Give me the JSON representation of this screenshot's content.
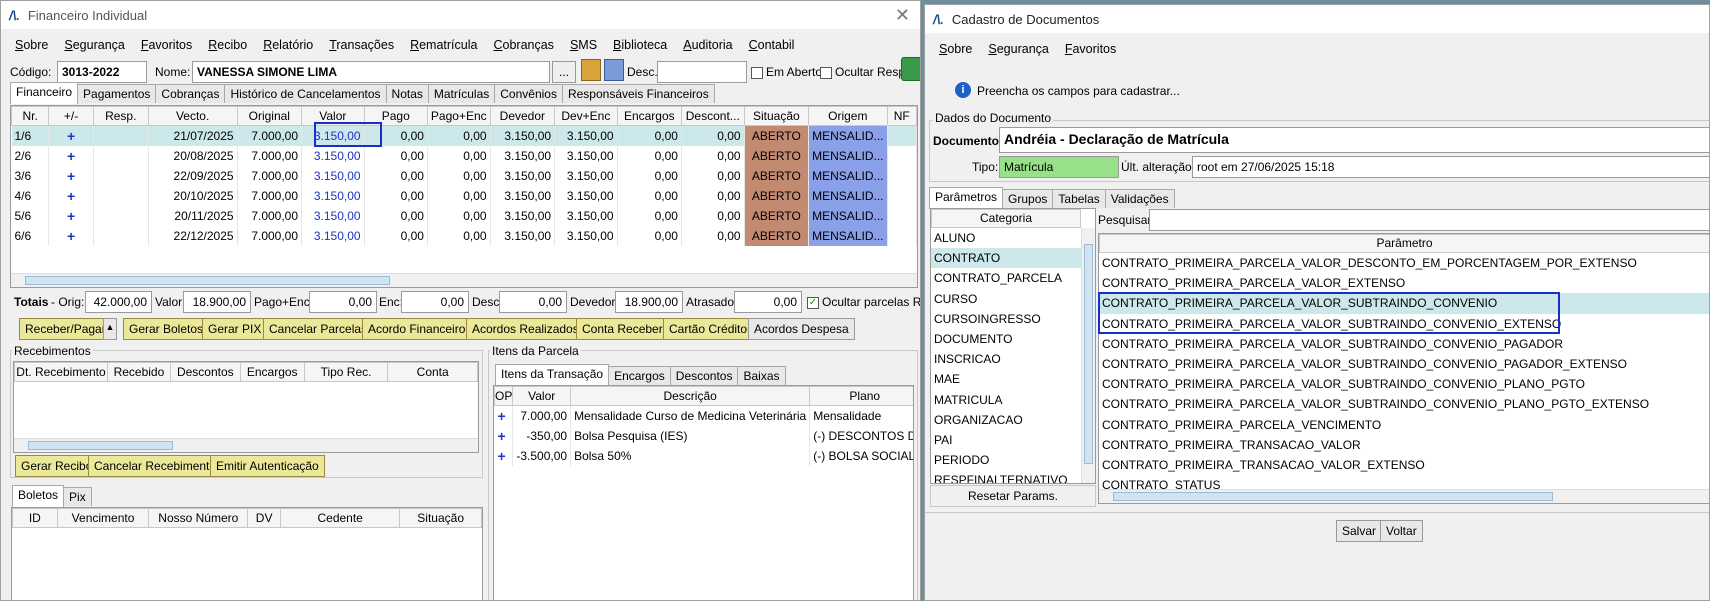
{
  "left": {
    "title": "Financeiro Individual",
    "menu": [
      "Sobre",
      "Segurança",
      "Favoritos",
      "Recibo",
      "Relatório",
      "Transações",
      "Rematrícula",
      "Cobranças",
      "SMS",
      "Biblioteca",
      "Auditoria",
      "Contabil"
    ],
    "codigo_label": "Código:",
    "codigo": "3013-2022",
    "nome_label": "Nome:",
    "nome": "VANESSA SIMONE LIMA",
    "ellipsis": "...",
    "desc_label": "Desc.:",
    "em_aberto": "Em Aberto",
    "ocultar_resp": "Ocultar Resp.",
    "tabs": [
      "Financeiro",
      "Pagamentos",
      "Cobranças",
      "Histórico de Cancelamentos",
      "Notas",
      "Matrículas",
      "Convênios",
      "Responsáveis Financeiros"
    ],
    "columns": [
      "Nr.",
      "+/-",
      "Resp.",
      "Vecto.",
      "Original",
      "Valor",
      "Pago",
      "Pago+Enc",
      "Devedor",
      "Dev+Enc",
      "Encargos",
      "Descont...",
      "Situação",
      "Origem",
      "NF"
    ],
    "rows": [
      [
        "1/6",
        "+",
        "",
        "21/07/2025",
        "7.000,00",
        "3.150,00",
        "0,00",
        "0,00",
        "3.150,00",
        "3.150,00",
        "0,00",
        "0,00",
        "ABERTO",
        "MENSALID..."
      ],
      [
        "2/6",
        "+",
        "",
        "20/08/2025",
        "7.000,00",
        "3.150,00",
        "0,00",
        "0,00",
        "3.150,00",
        "3.150,00",
        "0,00",
        "0,00",
        "ABERTO",
        "MENSALID..."
      ],
      [
        "3/6",
        "+",
        "",
        "22/09/2025",
        "7.000,00",
        "3.150,00",
        "0,00",
        "0,00",
        "3.150,00",
        "3.150,00",
        "0,00",
        "0,00",
        "ABERTO",
        "MENSALID..."
      ],
      [
        "4/6",
        "+",
        "",
        "20/10/2025",
        "7.000,00",
        "3.150,00",
        "0,00",
        "0,00",
        "3.150,00",
        "3.150,00",
        "0,00",
        "0,00",
        "ABERTO",
        "MENSALID..."
      ],
      [
        "5/6",
        "+",
        "",
        "20/11/2025",
        "7.000,00",
        "3.150,00",
        "0,00",
        "0,00",
        "3.150,00",
        "3.150,00",
        "0,00",
        "0,00",
        "ABERTO",
        "MENSALID..."
      ],
      [
        "6/6",
        "+",
        "",
        "22/12/2025",
        "7.000,00",
        "3.150,00",
        "0,00",
        "0,00",
        "3.150,00",
        "3.150,00",
        "0,00",
        "0,00",
        "ABERTO",
        "MENSALID..."
      ]
    ],
    "totais": {
      "label": "Totais",
      "orig_label": "- Orig:",
      "orig": "42.000,00",
      "valor_label": "Valor:",
      "valor": "18.900,00",
      "pagoenc_label": "Pago+Enc:",
      "pagoenc": "0,00",
      "enc_label": "Enc:",
      "enc": "0,00",
      "desc_label": "Desc:",
      "desc": "0,00",
      "devedor_label": "Devedor:",
      "devedor": "18.900,00",
      "atrasado_label": "Atrasado:",
      "atrasado": "0,00",
      "ocultar": "Ocultar parcelas RC"
    },
    "buttons": [
      "Receber/Pagar",
      "Gerar Boletos",
      "Gerar PIX",
      "Cancelar Parcelas",
      "Acordo Financeiro",
      "Acordos Realizados",
      "Conta Receber",
      "Cartão Crédito",
      "Acordos Despesa"
    ],
    "recebimentos": {
      "title": "Recebimentos",
      "columns": [
        "Dt. Recebimento",
        "Recebido",
        "Descontos",
        "Encargos",
        "Tipo Rec.",
        "Conta"
      ],
      "buttons": [
        "Gerar Recibo",
        "Cancelar Recebimento",
        "Emitir Autenticação"
      ]
    },
    "itens": {
      "title": "Itens da Parcela",
      "tabs": [
        "Itens da Transação",
        "Encargos",
        "Descontos",
        "Baixas"
      ],
      "columns": [
        "OP",
        "Valor",
        "Descrição",
        "Plano"
      ],
      "rows": [
        [
          "+",
          "7.000,00",
          "Mensalidade Curso de Medicina Veterinária",
          "Mensalidade"
        ],
        [
          "+",
          "-350,00",
          "Bolsa Pesquisa (IES)",
          "(-) DESCONTOS D"
        ],
        [
          "+",
          "-3.500,00",
          "Bolsa 50%",
          "(-) BOLSA SOCIAL"
        ]
      ]
    },
    "boletos": {
      "tabs": [
        "Boletos",
        "Pix"
      ],
      "columns": [
        "ID",
        "Vencimento",
        "Nosso Número",
        "DV",
        "Cedente",
        "Situação"
      ]
    }
  },
  "right": {
    "title": "Cadastro de Documentos",
    "menu": [
      "Sobre",
      "Segurança",
      "Favoritos"
    ],
    "info": "Preencha os campos para cadastrar...",
    "section": "Dados do Documento",
    "documento_label": "Documento:",
    "documento": "Andréia - Declaração de Matrícula",
    "tipo_label": "Tipo:",
    "tipo": "Matrícula",
    "ult_label": "Últ. alteração:",
    "ult": "root em 27/06/2025 15:18",
    "tabs": [
      "Parâmetros",
      "Grupos",
      "Tabelas",
      "Validações"
    ],
    "categoria_header": "Categoria",
    "categorias": [
      "ALUNO",
      "CONTRATO",
      "CONTRATO_PARCELA",
      "CURSO",
      "CURSOINGRESSO",
      "DOCUMENTO",
      "INSCRICAO",
      "MAE",
      "MATRICULA",
      "ORGANIZACAO",
      "PAI",
      "PERIODO",
      "RESPFINALTERNATIVO"
    ],
    "pesquisar_label": "Pesquisar:",
    "parametro_header": "Parâmetro",
    "parametros": [
      "CONTRATO_PRIMEIRA_PARCELA_VALOR_DESCONTO_EM_PORCENTAGEM_POR_EXTENSO",
      "CONTRATO_PRIMEIRA_PARCELA_VALOR_EXTENSO",
      "CONTRATO_PRIMEIRA_PARCELA_VALOR_SUBTRAINDO_CONVENIO",
      "CONTRATO_PRIMEIRA_PARCELA_VALOR_SUBTRAINDO_CONVENIO_EXTENSO",
      "CONTRATO_PRIMEIRA_PARCELA_VALOR_SUBTRAINDO_CONVENIO_PAGADOR",
      "CONTRATO_PRIMEIRA_PARCELA_VALOR_SUBTRAINDO_CONVENIO_PAGADOR_EXTENSO",
      "CONTRATO_PRIMEIRA_PARCELA_VALOR_SUBTRAINDO_CONVENIO_PLANO_PGTO",
      "CONTRATO_PRIMEIRA_PARCELA_VALOR_SUBTRAINDO_CONVENIO_PLANO_PGTO_EXTENSO",
      "CONTRATO_PRIMEIRA_PARCELA_VENCIMENTO",
      "CONTRATO_PRIMEIRA_TRANSACAO_VALOR",
      "CONTRATO_PRIMEIRA_TRANSACAO_VALOR_EXTENSO",
      "CONTRATO_STATUS"
    ],
    "resetar": "Resetar Params.",
    "salvar": "Salvar",
    "voltar": "Voltar"
  }
}
